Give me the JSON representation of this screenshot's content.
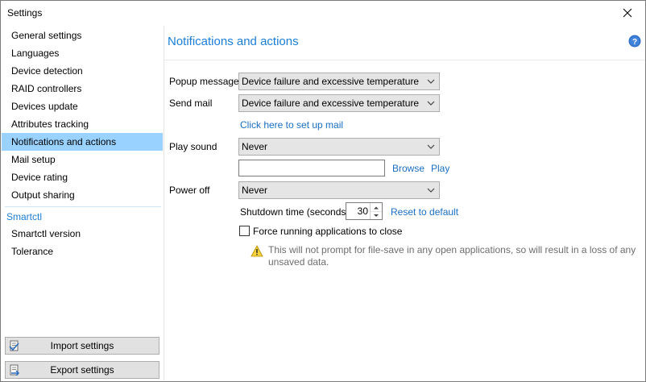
{
  "window": {
    "title": "Settings"
  },
  "sidebar": {
    "items": [
      {
        "label": "General settings"
      },
      {
        "label": "Languages"
      },
      {
        "label": "Device detection"
      },
      {
        "label": "RAID controllers"
      },
      {
        "label": "Devices update"
      },
      {
        "label": "Attributes tracking"
      },
      {
        "label": "Notifications and actions"
      },
      {
        "label": "Mail setup"
      },
      {
        "label": "Device rating"
      },
      {
        "label": "Output sharing"
      }
    ],
    "section_header": "Smartctl",
    "section_items": [
      {
        "label": "Smartctl version"
      },
      {
        "label": "Tolerance"
      }
    ],
    "import_label": "Import settings",
    "export_label": "Export settings",
    "selected_index": 6
  },
  "main": {
    "heading": "Notifications and actions",
    "popup_label": "Popup message",
    "popup_value": "Device failure and excessive temperature",
    "mail_label": "Send mail",
    "mail_value": "Device failure and excessive temperature",
    "mail_setup_link": "Click here to set up mail",
    "sound_label": "Play sound",
    "sound_value": "Never",
    "sound_file_value": "",
    "browse_link": "Browse",
    "play_link": "Play",
    "power_label": "Power off",
    "power_value": "Never",
    "shutdown_label": "Shutdown time (seconds)",
    "shutdown_value": "30",
    "reset_link": "Reset to default",
    "force_close_label": "Force running applications to close",
    "force_close_checked": false,
    "warning_text": "This will not prompt for file-save in any open applications, so will result in a loss of any unsaved data."
  },
  "colors": {
    "accent": "#1a7dd6",
    "selected_bg": "#99d1ff",
    "link": "#1a6fc4"
  }
}
